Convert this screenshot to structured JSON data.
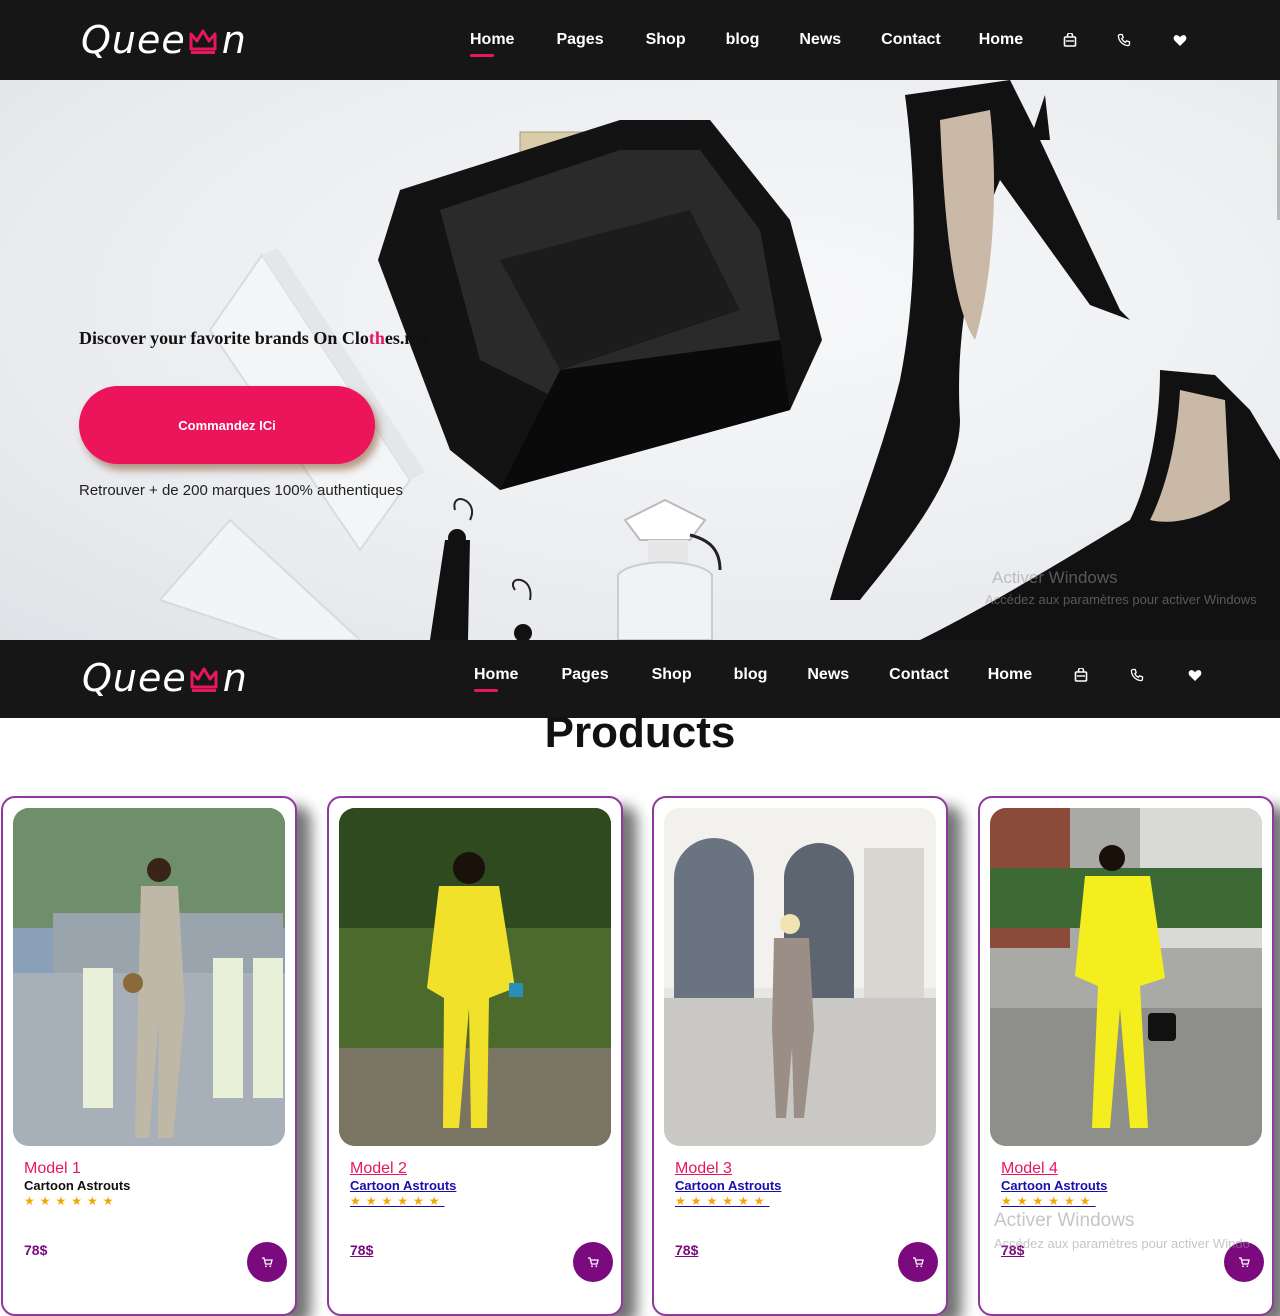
{
  "brand": {
    "logo_left": "Quee",
    "logo_right": "n"
  },
  "nav": {
    "items": [
      "Home",
      "Pages",
      "Shop",
      "blog",
      "News",
      "Contact",
      "Home"
    ],
    "icons": [
      "bag-icon",
      "phone-icon",
      "heart-icon"
    ]
  },
  "hero": {
    "title_before": "Discover your favorite brands On Clo",
    "title_highlight": "th",
    "title_after": "es.ma",
    "button_label": "Commandez ICi",
    "subtitle": "Retrouver + de 200 marques 100% authentiques"
  },
  "products": {
    "title": "Products",
    "items": [
      {
        "model": "Model 1",
        "name": "Cartoon Astrouts",
        "stars": "★★★★★★",
        "price": "78$"
      },
      {
        "model": "Model 2",
        "name": "Cartoon Astrouts",
        "stars": "★★★★★★",
        "price": "78$"
      },
      {
        "model": "Model 3",
        "name": "Cartoon Astrouts",
        "stars": "★★★★★★",
        "price": "78$"
      },
      {
        "model": "Model 4",
        "name": "Cartoon Astrouts",
        "stars": "★★★★★★",
        "price": "78$"
      }
    ]
  },
  "watermark": {
    "line1": "Activer Windows",
    "line2": "Accédez aux paramètres pour activer Windows",
    "line2_short": "Accédez aux paramètres pour activer Windo"
  },
  "colors": {
    "accent": "#e8175d",
    "nav_bg": "#161616",
    "price": "#7b0a7e"
  }
}
